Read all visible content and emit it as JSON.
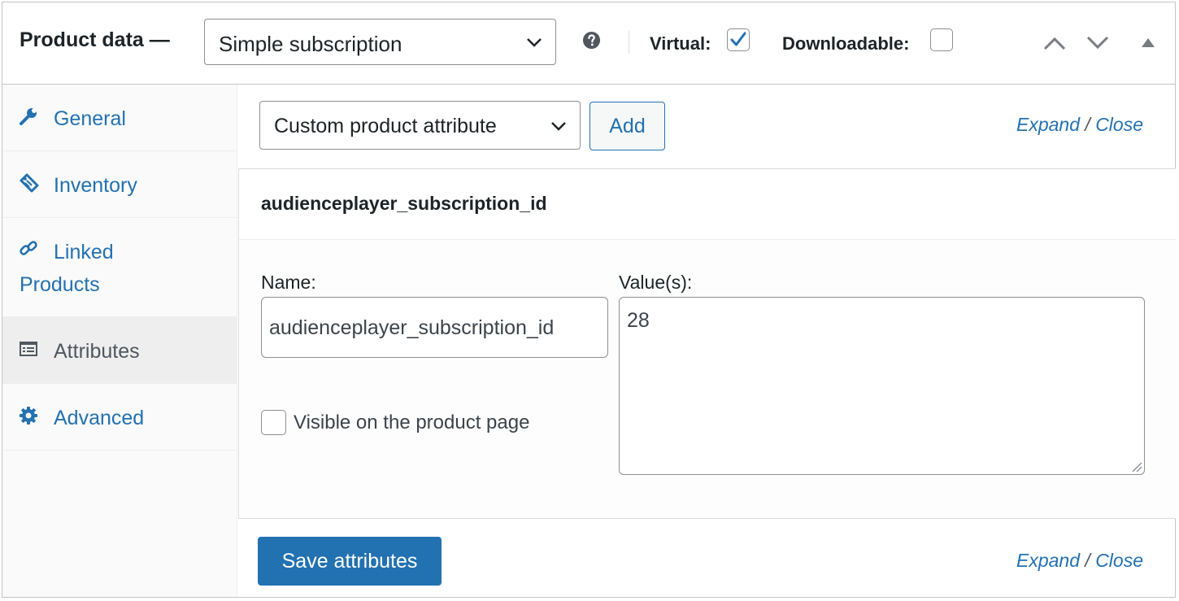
{
  "header": {
    "title": "Product data —",
    "product_type": "Simple subscription",
    "virtual_label": "Virtual:",
    "virtual_checked": true,
    "downloadable_label": "Downloadable:",
    "downloadable_checked": false
  },
  "sidebar": {
    "active": "Attributes",
    "items": [
      {
        "label": "General",
        "icon": "wrench-icon"
      },
      {
        "label": "Inventory",
        "icon": "tag-icon"
      },
      {
        "label": "Linked",
        "label2": "Products",
        "icon": "link-icon"
      },
      {
        "label": "Attributes",
        "icon": "list-icon"
      },
      {
        "label": "Advanced",
        "icon": "gear-icon"
      }
    ]
  },
  "toolbar": {
    "attribute_select": "Custom product attribute",
    "add_label": "Add",
    "expand_label": "Expand",
    "separator": "/",
    "close_label": "Close"
  },
  "attribute": {
    "heading": "audienceplayer_subscription_id",
    "name_label": "Name:",
    "name_value": "audienceplayer_subscription_id",
    "values_label": "Value(s):",
    "values_value": "28",
    "visible_label": "Visible on the product page",
    "visible_checked": false
  },
  "footer": {
    "save_label": "Save attributes",
    "expand_label": "Expand",
    "separator": "/",
    "close_label": "Close"
  },
  "colors": {
    "link": "#2271b1",
    "button_primary": "#2271b1",
    "border": "#c3c4c7"
  }
}
